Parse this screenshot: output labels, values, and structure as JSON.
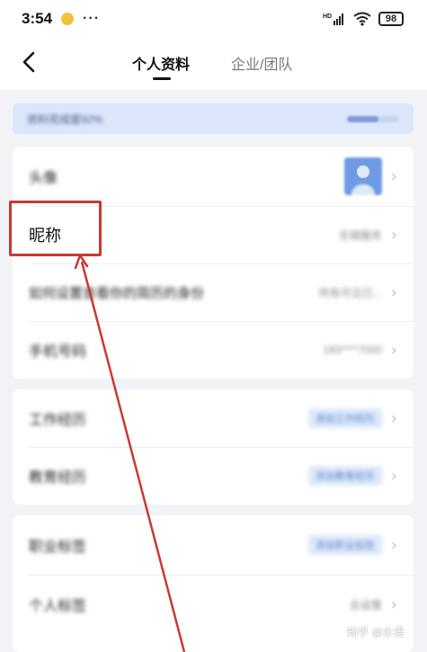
{
  "status_bar": {
    "time": "3:54",
    "more": "···",
    "network": "HD",
    "battery": "98"
  },
  "header": {
    "tabs": [
      {
        "label": "个人资料"
      },
      {
        "label": "企业/团队"
      }
    ]
  },
  "banner": {
    "text": "资料完成度92%",
    "progress": 0.6
  },
  "profile": {
    "avatar_label": "头像",
    "nickname_label": "昵称",
    "nickname_value": "无锡服务",
    "feature_label": "如何设置查看你的简历的身份",
    "feature_value": "所有可见已...",
    "phone_label": "手机号码",
    "phone_value": "183****7000"
  },
  "experience": {
    "work_label": "工作经历",
    "work_tag": "添加工作经历",
    "edu_label": "教育经历",
    "edu_tag": "添加教育经历"
  },
  "tags": {
    "skill_label": "职业标签",
    "skill_tag": "添加职业标签",
    "personal_label": "个人标签",
    "personal_value": "去设置"
  },
  "watermark": "知乎 @水语",
  "colors": {
    "accent": "#6f9be4",
    "annotation": "#c93a32",
    "background": "#f2f3f6"
  }
}
